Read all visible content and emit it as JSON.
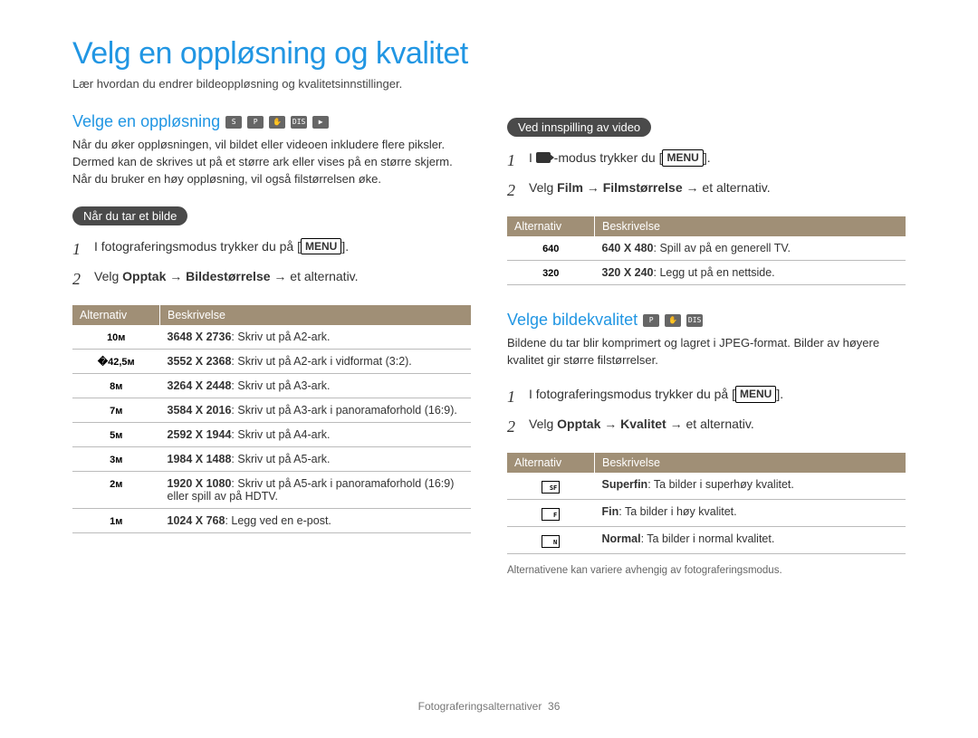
{
  "title": "Velg en oppløsning og kvalitet",
  "subtitle": "Lær hvordan du endrer bildeoppløsning og kvalitetsinnstillinger.",
  "left": {
    "heading": "Velge en oppløsning",
    "modes": [
      "SMART",
      "P",
      "hand",
      "DIS",
      "video"
    ],
    "intro": "Når du øker oppløsningen, vil bildet eller videoen inkludere flere piksler. Dermed kan de skrives ut på et større ark eller vises på en større skjerm. Når du bruker en høy oppløsning, vil også filstørrelsen øke.",
    "pill": "Når du tar et bilde",
    "steps": {
      "s1_pre": "I fotograferingsmodus trykker du på [",
      "s1_btn": "MENU",
      "s1_post": "].",
      "s2a": "Velg ",
      "s2b": "Opptak → Bildestørrelse",
      "s2c": " → et alternativ."
    },
    "table": {
      "h1": "Alternativ",
      "h2": "Beskrivelse",
      "rows": [
        {
          "icon": "10м",
          "b": "3648 X 2736",
          "t": ": Skriv ut på A2-ark."
        },
        {
          "icon": "�42,5м⁠",
          "b": "3552 X 2368",
          "t": ": Skriv ut på A2-ark i vidformat (3:2)."
        },
        {
          "icon": "8м",
          "b": "3264 X 2448",
          "t": ": Skriv ut på A3-ark."
        },
        {
          "icon": "7м",
          "b": "3584 X 2016",
          "t": ": Skriv ut på A3-ark i panoramaforhold (16:9)."
        },
        {
          "icon": "5м",
          "b": "2592 X 1944",
          "t": ": Skriv ut på A4-ark."
        },
        {
          "icon": "3м",
          "b": "1984 X 1488",
          "t": ": Skriv ut på A5-ark."
        },
        {
          "icon": "2м",
          "b": "1920 X 1080",
          "t": ": Skriv ut på A5-ark i panoramaforhold (16:9) eller spill av på HDTV."
        },
        {
          "icon": "1м",
          "b": "1024 X 768",
          "t": ": Legg ved en e-post."
        }
      ]
    }
  },
  "right": {
    "pill": "Ved innspilling av video",
    "steps": {
      "s1_pre": "I ",
      "s1_mid": " -modus trykker du [",
      "s1_btn": "MENU",
      "s1_post": "].",
      "s2a": "Velg ",
      "s2b": "Film → Filmstørrelse",
      "s2c": " → et alternativ."
    },
    "table": {
      "h1": "Alternativ",
      "h2": "Beskrivelse",
      "rows": [
        {
          "icon": "640",
          "b": "640 X 480",
          "t": ": Spill av på en generell TV."
        },
        {
          "icon": "320",
          "b": "320 X 240",
          "t": ": Legg ut på en nettside."
        }
      ]
    },
    "quality": {
      "heading": "Velge bildekvalitet",
      "modes": [
        "P",
        "hand",
        "DIS"
      ],
      "intro": "Bildene du tar blir komprimert og lagret i JPEG-format. Bilder av høyere kvalitet gir større filstørrelser.",
      "steps": {
        "s1_pre": "I fotograferingsmodus trykker du på [",
        "s1_btn": "MENU",
        "s1_post": "].",
        "s2a": "Velg ",
        "s2b": "Opptak → Kvalitet",
        "s2c": " → et alternativ."
      },
      "table": {
        "h1": "Alternativ",
        "h2": "Beskrivelse",
        "rows": [
          {
            "icon": "SF",
            "b": "Superfin",
            "t": ": Ta bilder i superhøy kvalitet."
          },
          {
            "icon": "F",
            "b": "Fin",
            "t": ": Ta bilder i høy kvalitet."
          },
          {
            "icon": "N",
            "b": "Normal",
            "t": ": Ta bilder i normal kvalitet."
          }
        ]
      },
      "footnote": "Alternativene kan variere avhengig av fotograferingsmodus."
    }
  },
  "footer": {
    "section": "Fotograferingsalternativer",
    "page": "36"
  }
}
